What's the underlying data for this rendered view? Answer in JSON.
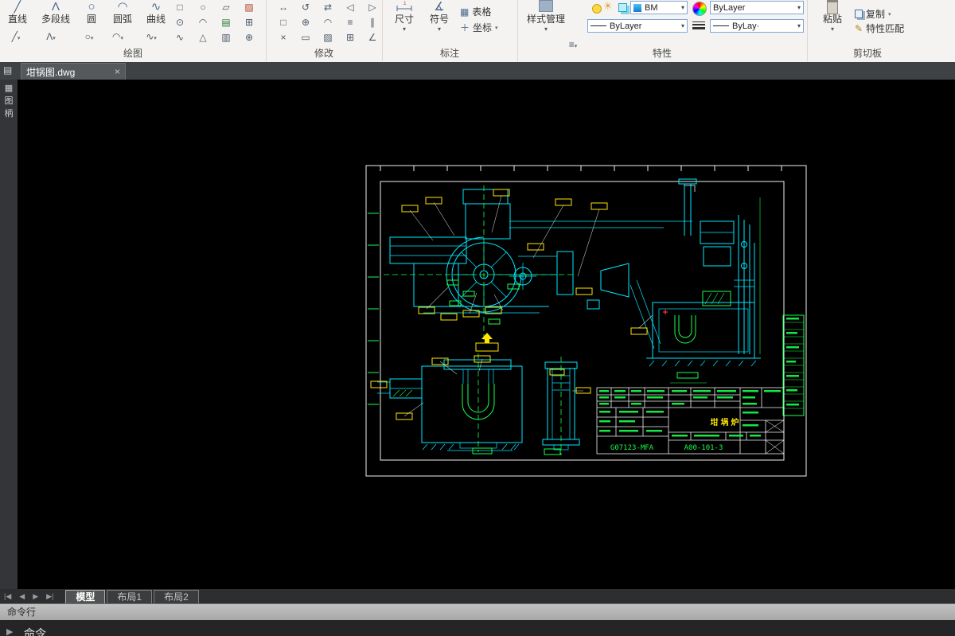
{
  "colors": {
    "cad_cyan": "#00e8ff",
    "cad_green": "#17ff4d",
    "cad_yellow": "#ffe600",
    "cad_white": "#f0f0f0",
    "accent_blue": "#1976d2"
  },
  "icons": {
    "line": "╱",
    "polyline": "Λ",
    "circle": "○",
    "arc": "◠",
    "spline": "∿",
    "dropdown": "▾",
    "table": "▦",
    "coord": "＋",
    "symbol": "∡",
    "menu": "≡",
    "match": "✎",
    "doc": "▤",
    "palette": "▦",
    "nav_first": "|◀",
    "nav_prev": "◀",
    "nav_next": "▶",
    "nav_last": "▶|",
    "close": "×"
  },
  "draw_grid": [
    "□",
    "○",
    "▱",
    "▨",
    "⊙",
    "◠",
    "▤",
    "⊞",
    "∿",
    "△",
    "▥",
    "⊕"
  ],
  "modify_grid": [
    "↔",
    "↺",
    "⇄",
    "◁",
    "▷",
    "□",
    "⊕",
    "◠",
    "≡",
    "∥",
    "×",
    "▭",
    "▨",
    "⊞",
    "∠"
  ],
  "ribbon": {
    "draw": {
      "label": "绘图",
      "buttons": [
        "直线",
        "多段线",
        "圆",
        "圆弧",
        "曲线"
      ]
    },
    "modify": {
      "label": "修改"
    },
    "annotate": {
      "label": "标注",
      "dimension": "尺寸",
      "symbol": "符号",
      "table": "表格",
      "coordinate": "坐标"
    },
    "properties": {
      "label": "特性",
      "style_manager": "样式管理",
      "bm": "BM",
      "bylayer_top": "ByLayer",
      "bylayer_linetype": "ByLayer",
      "bylayer_lineweight": "ByLay·"
    },
    "clipboard": {
      "label": "剪切板",
      "paste": "粘贴",
      "copy": "复制",
      "match_props": "特性匹配"
    }
  },
  "doc_tabs": {
    "active_title": "坩锅图.dwg",
    "close": "×"
  },
  "side_strip": {
    "item1": "图",
    "item2": "柄"
  },
  "drawing": {
    "title_text": "坩埚炉",
    "drawing_number": "G07123-MFA",
    "sheet_number": "A00-101-3"
  },
  "layout_tabs": {
    "model": "模型",
    "layout1": "布局1",
    "layout2": "布局2"
  },
  "command": {
    "panel_title": "命令行",
    "prompt": "命令"
  }
}
